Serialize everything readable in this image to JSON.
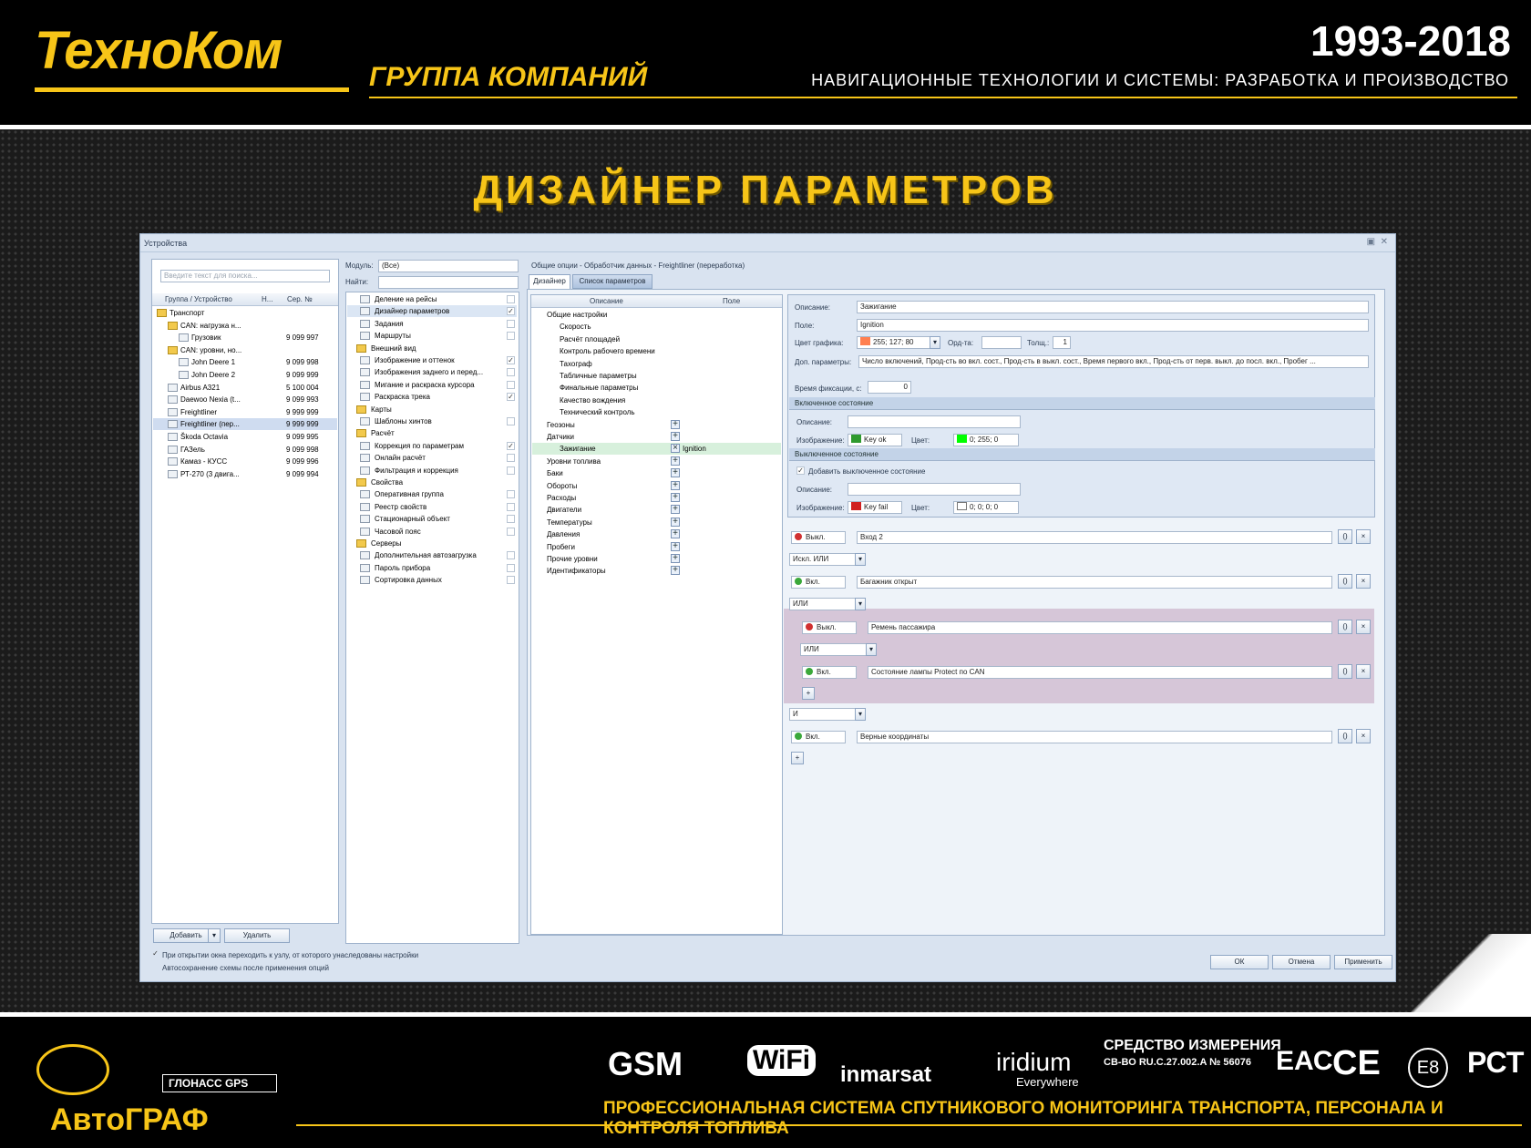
{
  "header": {
    "logo": "ТехноКом",
    "group": "ГРУППА КОМПАНИЙ",
    "years": "1993-2018",
    "tagline": "НАВИГАЦИОННЫЕ ТЕХНОЛОГИИ И СИСТЕМЫ: РАЗРАБОТКА И ПРОИЗВОДСТВО"
  },
  "title": "ДИЗАЙНЕР ПАРАМЕТРОВ",
  "window": {
    "title": "Устройства"
  },
  "devices": {
    "search_placeholder": "Введите текст для поиска...",
    "columns": [
      "Группа / Устройство",
      "Н...",
      "Сер. №"
    ],
    "rows": [
      {
        "name": "Транспорт",
        "serial": ""
      },
      {
        "name": "CAN: нагрузка н...",
        "serial": ""
      },
      {
        "name": "Грузовик",
        "serial": "9 099 997"
      },
      {
        "name": "CAN: уровни, но...",
        "serial": ""
      },
      {
        "name": "John Deere 1",
        "serial": "9 099 998"
      },
      {
        "name": "John Deere 2",
        "serial": "9 099 999"
      },
      {
        "name": "Airbus A321",
        "serial": "5 100 004"
      },
      {
        "name": "Daewoo Nexia (t...",
        "serial": "9 099 993"
      },
      {
        "name": "Freightliner",
        "serial": "9 999 999"
      },
      {
        "name": "Freightliner (пер...",
        "serial": "9 999 999"
      },
      {
        "name": "Škoda Octavia",
        "serial": "9 099 995"
      },
      {
        "name": "ГАЗель",
        "serial": "9 099 998"
      },
      {
        "name": "Камаз - КУСС",
        "serial": "9 099 996"
      },
      {
        "name": "РТ-270 (3 двига...",
        "serial": "9 099 994"
      }
    ],
    "add_label": "Добавить",
    "delete_label": "Удалить"
  },
  "modules": {
    "module_label": "Модуль:",
    "module_value": "(Все)",
    "find_label": "Найти:",
    "items": [
      {
        "label": "Деление на рейсы",
        "level": 1,
        "checked": false
      },
      {
        "label": "Дизайнер параметров",
        "level": 1,
        "checked": true
      },
      {
        "label": "Задания",
        "level": 1,
        "checked": false
      },
      {
        "label": "Маршруты",
        "level": 1,
        "checked": false
      },
      {
        "label": "Внешний вид",
        "level": 0,
        "checked": false
      },
      {
        "label": "Изображение и оттенок",
        "level": 1,
        "checked": true
      },
      {
        "label": "Изображения заднего и перед...",
        "level": 1,
        "checked": false
      },
      {
        "label": "Мигание и раскраска курсора",
        "level": 1,
        "checked": false
      },
      {
        "label": "Раскраска трека",
        "level": 1,
        "checked": true
      },
      {
        "label": "Карты",
        "level": 0,
        "checked": false
      },
      {
        "label": "Шаблоны хинтов",
        "level": 1,
        "checked": false
      },
      {
        "label": "Расчёт",
        "level": 0,
        "checked": false
      },
      {
        "label": "Коррекция по параметрам",
        "level": 1,
        "checked": true
      },
      {
        "label": "Онлайн расчёт",
        "level": 1,
        "checked": false
      },
      {
        "label": "Фильтрация и коррекция",
        "level": 1,
        "checked": false
      },
      {
        "label": "Свойства",
        "level": 0,
        "checked": false
      },
      {
        "label": "Оперативная группа",
        "level": 1,
        "checked": false
      },
      {
        "label": "Реестр свойств",
        "level": 1,
        "checked": false
      },
      {
        "label": "Стационарный объект",
        "level": 1,
        "checked": false
      },
      {
        "label": "Часовой пояс",
        "level": 1,
        "checked": false
      },
      {
        "label": "Серверы",
        "level": 0,
        "checked": false
      },
      {
        "label": "Дополнительная автозагрузка",
        "level": 1,
        "checked": false
      },
      {
        "label": "Пароль прибора",
        "level": 1,
        "checked": false
      },
      {
        "label": "Сортировка данных",
        "level": 1,
        "checked": false
      }
    ]
  },
  "editor": {
    "breadcrumb": "Общие опции - Обработчик данных - Freightliner (переработка)",
    "tabs": [
      "Дизайнер",
      "Список параметров"
    ],
    "tree_columns": [
      "Описание",
      "Поле"
    ],
    "tree": [
      {
        "label": "Общие настройки",
        "level": 0,
        "plus": false
      },
      {
        "label": "Скорость",
        "level": 1,
        "plus": false
      },
      {
        "label": "Расчёт площадей",
        "level": 1,
        "plus": false
      },
      {
        "label": "Контроль рабочего времени",
        "level": 1,
        "plus": false
      },
      {
        "label": "Тахограф",
        "level": 1,
        "plus": false
      },
      {
        "label": "Табличные параметры",
        "level": 1,
        "plus": false
      },
      {
        "label": "Финальные параметры",
        "level": 1,
        "plus": false
      },
      {
        "label": "Качество вождения",
        "level": 1,
        "plus": false
      },
      {
        "label": "Технический контроль",
        "level": 1,
        "plus": false
      },
      {
        "label": "Геозоны",
        "level": 0,
        "plus": true
      },
      {
        "label": "Датчики",
        "level": 0,
        "plus": true
      },
      {
        "label": "Зажигание",
        "level": 1,
        "plus": false,
        "field": "Ignition",
        "selected": true
      },
      {
        "label": "Уровни топлива",
        "level": 0,
        "plus": true
      },
      {
        "label": "Баки",
        "level": 0,
        "plus": true
      },
      {
        "label": "Обороты",
        "level": 0,
        "plus": true
      },
      {
        "label": "Расходы",
        "level": 0,
        "plus": true
      },
      {
        "label": "Двигатели",
        "level": 0,
        "plus": true
      },
      {
        "label": "Температуры",
        "level": 0,
        "plus": true
      },
      {
        "label": "Давления",
        "level": 0,
        "plus": true
      },
      {
        "label": "Пробеги",
        "level": 0,
        "plus": true
      },
      {
        "label": "Прочие уровни",
        "level": 0,
        "plus": true
      },
      {
        "label": "Идентификаторы",
        "level": 0,
        "plus": true
      }
    ]
  },
  "props": {
    "desc_label": "Описание:",
    "desc_value": "Зажигание",
    "field_label": "Поле:",
    "field_value": "Ignition",
    "color_label": "Цвет графика:",
    "color_value": "255; 127; 80",
    "color_hex": "#ff7f50",
    "ord_label": "Орд-та:",
    "thick_label": "Толщ.:",
    "thick_value": "1",
    "extra_label": "Доп. параметры:",
    "extra_value": "Число включений, Прод-сть во вкл. сост., Прод-сть в выкл. сост., Время первого вкл., Прод-сть от перв. выкл. до посл. вкл., Пробег ...",
    "fix_label": "Время фиксации, с:",
    "fix_value": "0",
    "on_section": "Включенное состояние",
    "on_desc_label": "Описание:",
    "on_img_label": "Изображение:",
    "on_img_value": "Key ok",
    "on_color_label": "Цвет:",
    "on_color_value": "0; 255; 0",
    "on_color_hex": "#00ff00",
    "off_section": "Выключенное состояние",
    "off_add_label": "Добавить выключенное состояние",
    "off_desc_label": "Описание:",
    "off_img_label": "Изображение:",
    "off_img_value": "Key fail",
    "off_color_label": "Цвет:",
    "off_color_value": "0; 0; 0; 0"
  },
  "conditions": {
    "rows": [
      {
        "state": "Выкл.",
        "dot": "#d03030",
        "param": "Вход 2"
      },
      {
        "op": "Искл. ИЛИ"
      },
      {
        "state": "Вкл.",
        "dot": "#3aa83a",
        "param": "Багажник открыт"
      },
      {
        "op": "ИЛИ"
      },
      {
        "state": "Выкл.",
        "dot": "#d03030",
        "param": "Ремень пассажира",
        "nested": true
      },
      {
        "op": "ИЛИ",
        "nested": true
      },
      {
        "state": "Вкл.",
        "dot": "#3aa83a",
        "param": "Состояние лампы Protect по CAN",
        "nested": true
      },
      {
        "op": "И"
      },
      {
        "state": "Вкл.",
        "dot": "#3aa83a",
        "param": "Верные координаты"
      }
    ],
    "bracket_label": "()",
    "remove_label": "×",
    "add_label": "+"
  },
  "bottom": {
    "opt1": "При открытии окна переходить к узлу, от которого унаследованы настройки",
    "opt2": "Автосохранение схемы после применения опций",
    "ok": "ОК",
    "cancel": "Отмена",
    "apply": "Применить"
  },
  "footer": {
    "brand": "АвтоГРАФ",
    "glonass": "ГЛОНАСС GPS",
    "logos": [
      "GSM",
      "WiFi",
      "inmarsat",
      "iridium"
    ],
    "iridium_sub": "Everywhere",
    "measure_title": "СРЕДСТВО ИЗМЕРЕНИЯ",
    "measure_code": "СВ-ВО RU.C.27.002.A № 56076",
    "cert_marks": [
      "ЕАС",
      "CE",
      "E8",
      "РСТ"
    ],
    "tagline": "ПРОФЕССИОНАЛЬНАЯ СИСТЕМА СПУТНИКОВОГО МОНИТОРИНГА ТРАНСПОРТА, ПЕРСОНАЛА И КОНТРОЛЯ ТОПЛИВА"
  }
}
